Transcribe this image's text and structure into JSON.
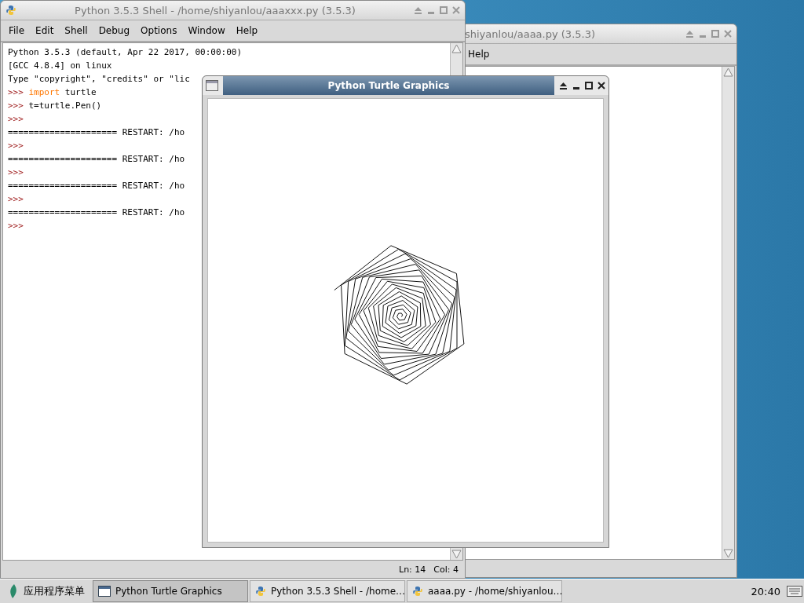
{
  "back_window": {
    "title": "shiyanlou/aaaa.py (3.5.3)",
    "menu": [
      "Help"
    ]
  },
  "shell_window": {
    "title": "Python 3.5.3 Shell - /home/shiyanlou/aaaxxx.py (3.5.3)",
    "menu": [
      "File",
      "Edit",
      "Shell",
      "Debug",
      "Options",
      "Window",
      "Help"
    ],
    "lines": [
      [
        {
          "kind": "output",
          "text": "Python 3.5.3 (default, Apr 22 2017, 00:00:00)"
        }
      ],
      [
        {
          "kind": "output",
          "text": "[GCC 4.8.4] on linux"
        }
      ],
      [
        {
          "kind": "output",
          "text": "Type \"copyright\", \"credits\" or \"lic"
        }
      ],
      [
        {
          "kind": "prompt",
          "text": ">>> "
        },
        {
          "kind": "keyword",
          "text": "import"
        },
        {
          "kind": "output",
          "text": " turtle"
        }
      ],
      [
        {
          "kind": "prompt",
          "text": ">>> "
        },
        {
          "kind": "output",
          "text": "t=turtle.Pen()"
        }
      ],
      [
        {
          "kind": "prompt",
          "text": ">>>"
        }
      ],
      [
        {
          "kind": "output",
          "text": "===================== RESTART: /ho"
        }
      ],
      [
        {
          "kind": "prompt",
          "text": ">>>"
        }
      ],
      [
        {
          "kind": "output",
          "text": "===================== RESTART: /ho"
        }
      ],
      [
        {
          "kind": "prompt",
          "text": ">>>"
        }
      ],
      [
        {
          "kind": "output",
          "text": "===================== RESTART: /ho"
        }
      ],
      [
        {
          "kind": "prompt",
          "text": ">>>"
        }
      ],
      [
        {
          "kind": "output",
          "text": "===================== RESTART: /ho"
        }
      ],
      [
        {
          "kind": "prompt",
          "text": ">>>"
        }
      ]
    ],
    "status": [
      "Ln: 14",
      "Col: 4"
    ]
  },
  "turtle_window": {
    "title": "Python Turtle Graphics"
  },
  "taskbar": {
    "start_menu": "应用程序菜单",
    "tasks": [
      {
        "label": "Python Turtle Graphics",
        "kind": "turtle",
        "selected": true
      },
      {
        "label": "Python 3.5.3 Shell - /home…",
        "kind": "python",
        "selected": false
      },
      {
        "label": "aaaa.py - /home/shiyanlou…",
        "kind": "python",
        "selected": false
      }
    ],
    "clock": "20:40"
  }
}
